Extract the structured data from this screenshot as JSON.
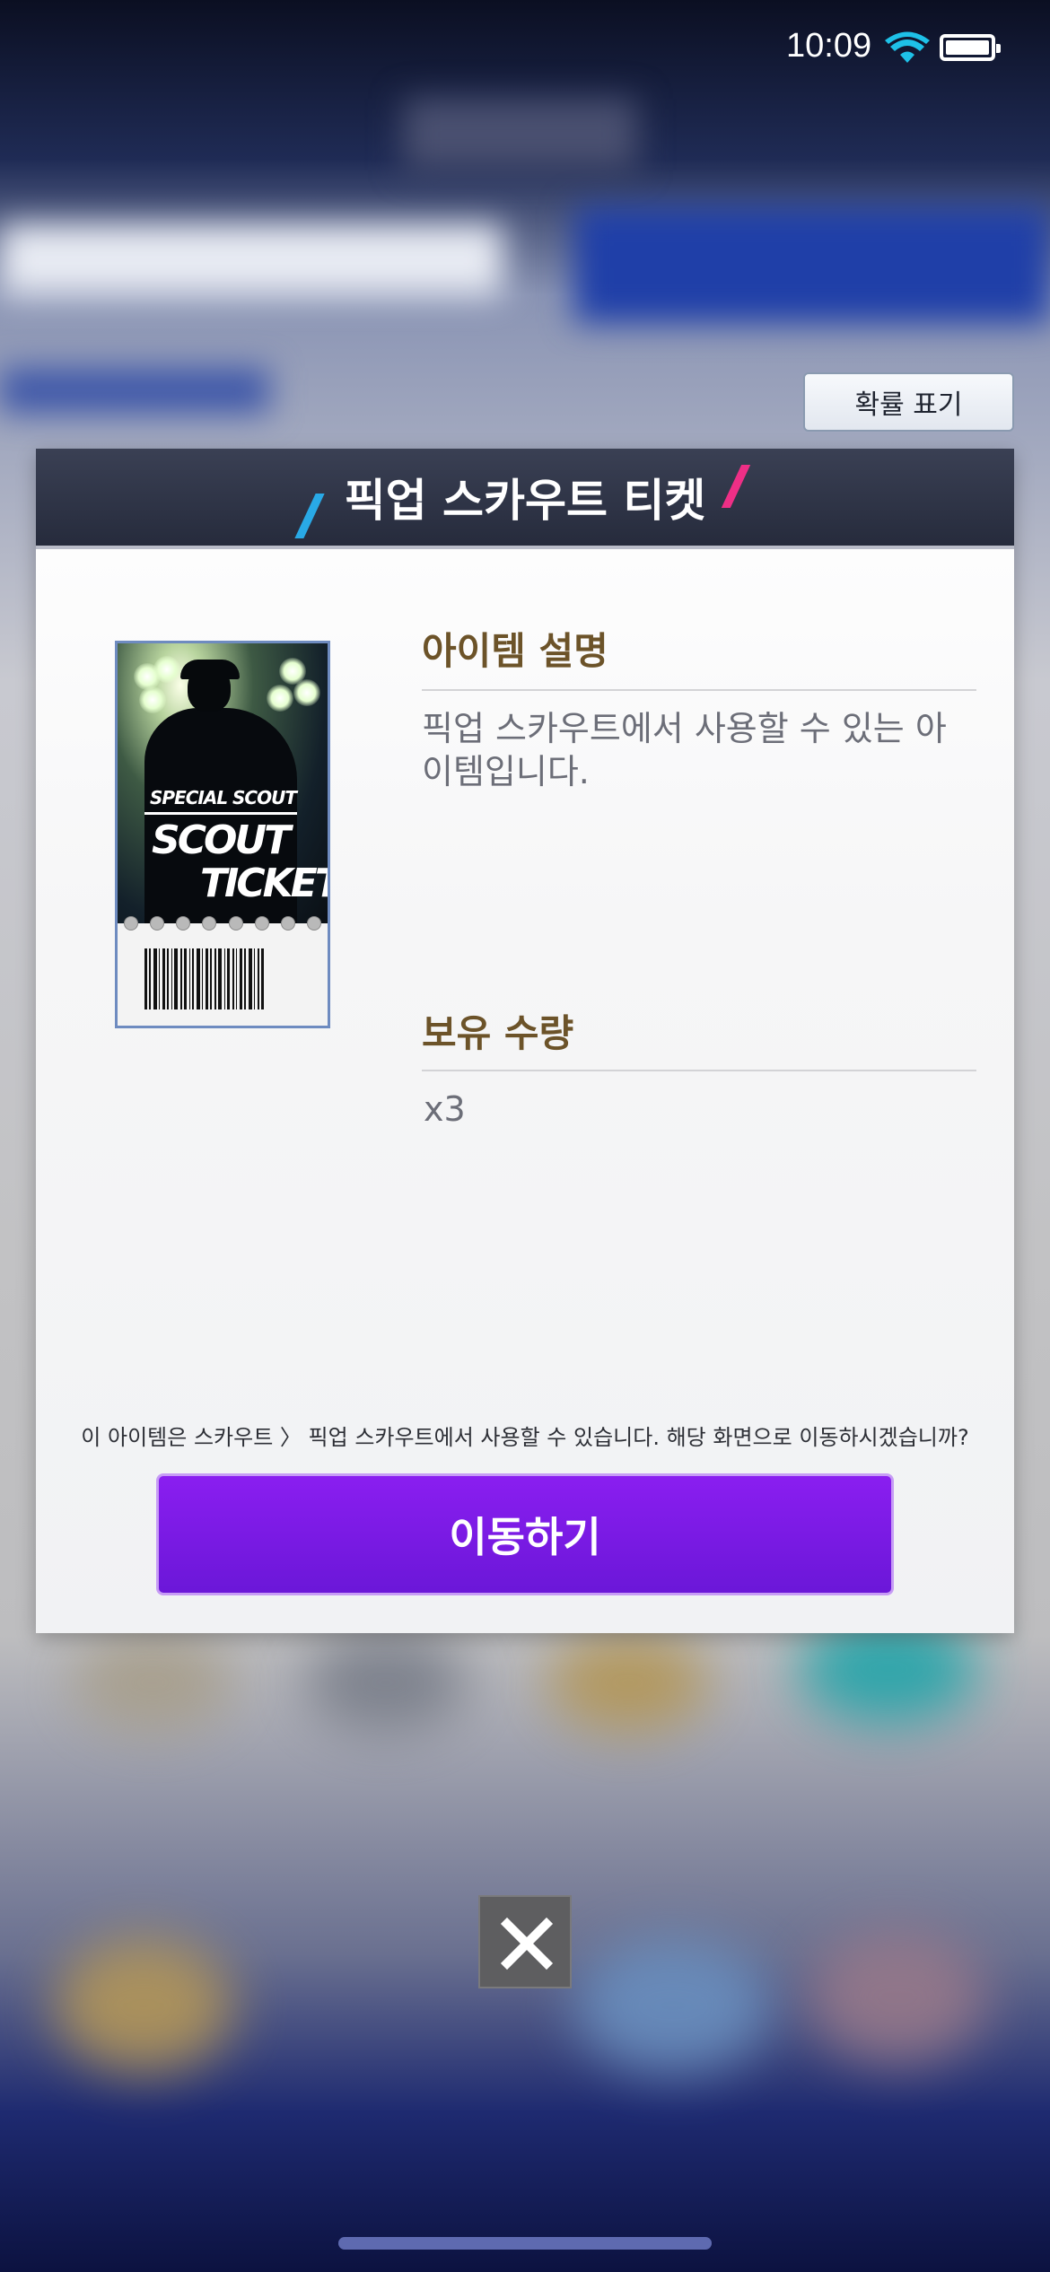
{
  "status_bar": {
    "time": "10:09"
  },
  "probability_button": {
    "label": "확률 표기"
  },
  "dialog": {
    "title": "픽업 스카우트 티켓",
    "ticket": {
      "special": "SPECIAL SCOUT",
      "line1": "SCOUT",
      "line2": "TICKET"
    },
    "description_heading": "아이템 설명",
    "description_text": "픽업 스카우트에서 사용할 수 있는 아이템입니다.",
    "quantity_heading": "보유 수량",
    "quantity_value": "x3",
    "notice": "이 아이템은 스카우트 〉 픽업 스카우트에서 사용할 수 있습니다. 해당 화면으로 이동하시겠습니까?",
    "move_button": "이동하기"
  },
  "icons": {
    "close": "close-icon",
    "wifi": "wifi-icon",
    "battery": "battery-icon"
  },
  "colors": {
    "title_bar": "#262b3c",
    "heading": "#6c5329",
    "button": "#7a1be8"
  }
}
